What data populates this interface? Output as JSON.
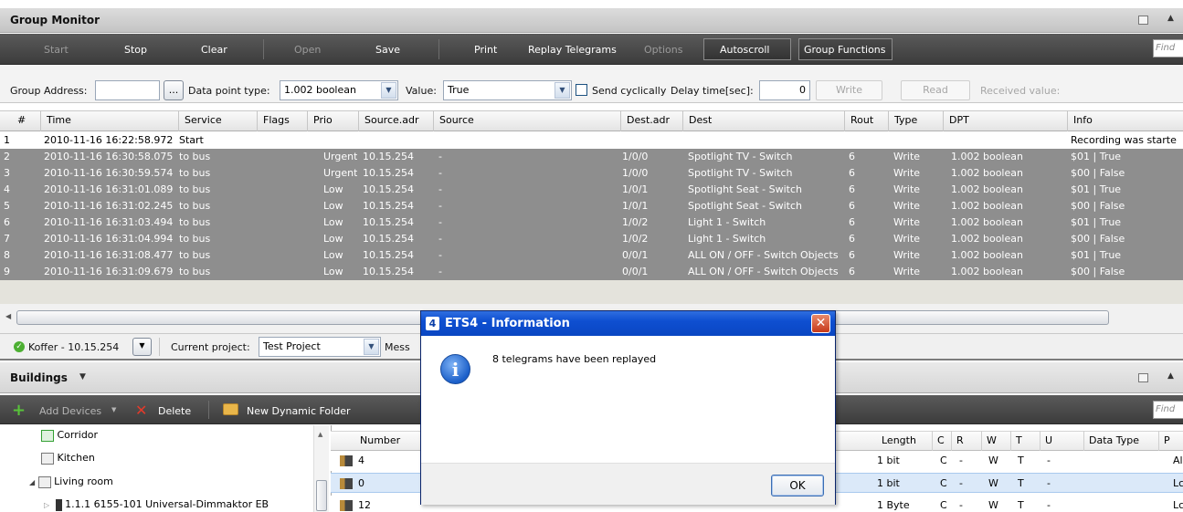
{
  "group_monitor": {
    "title": "Group Monitor",
    "toolbar": {
      "start": "Start",
      "stop": "Stop",
      "clear": "Clear",
      "open": "Open",
      "save": "Save",
      "print": "Print",
      "replay": "Replay Telegrams",
      "options": "Options",
      "autoscroll": "Autoscroll",
      "group_functions": "Group Functions",
      "find_placeholder": "Find"
    },
    "form": {
      "group_address_label": "Group Address:",
      "group_address_value": "",
      "browse_label": "...",
      "dpt_label": "Data point type:",
      "dpt_value": "1.002 boolean",
      "value_label": "Value:",
      "value_value": "True",
      "send_cyclically_label": "Send cyclically",
      "send_cyclically_checked": false,
      "delay_label": "Delay time[sec]:",
      "delay_value": "0",
      "write_label": "Write",
      "read_label": "Read",
      "received_label": "Received value:"
    },
    "columns": [
      "#",
      "Time",
      "Service",
      "Flags",
      "Prio",
      "Source.adr",
      "Source",
      "Dest.adr",
      "Dest",
      "Rout",
      "Type",
      "DPT",
      "Info"
    ],
    "rows": [
      {
        "n": "1",
        "time": "2010-11-16 16:22:58.972",
        "service": "Start",
        "flags": "",
        "prio": "",
        "src_adr": "",
        "src": "",
        "dest_adr": "",
        "dest": "",
        "rout": "",
        "type": "",
        "dpt": "",
        "info": "Recording was starte"
      },
      {
        "n": "2",
        "time": "2010-11-16 16:30:58.075",
        "service": "to bus",
        "flags": "",
        "prio": "Urgent",
        "src_adr": "10.15.254",
        "src": "-",
        "dest_adr": "1/0/0",
        "dest": "Spotlight TV - Switch",
        "rout": "6",
        "type": "Write",
        "dpt": "1.002 boolean",
        "info": "$01 | True"
      },
      {
        "n": "3",
        "time": "2010-11-16 16:30:59.574",
        "service": "to bus",
        "flags": "",
        "prio": "Urgent",
        "src_adr": "10.15.254",
        "src": "-",
        "dest_adr": "1/0/0",
        "dest": "Spotlight TV - Switch",
        "rout": "6",
        "type": "Write",
        "dpt": "1.002 boolean",
        "info": "$00 | False"
      },
      {
        "n": "4",
        "time": "2010-11-16 16:31:01.089",
        "service": "to bus",
        "flags": "",
        "prio": "Low",
        "src_adr": "10.15.254",
        "src": "-",
        "dest_adr": "1/0/1",
        "dest": "Spotlight Seat - Switch",
        "rout": "6",
        "type": "Write",
        "dpt": "1.002 boolean",
        "info": "$01 | True"
      },
      {
        "n": "5",
        "time": "2010-11-16 16:31:02.245",
        "service": "to bus",
        "flags": "",
        "prio": "Low",
        "src_adr": "10.15.254",
        "src": "-",
        "dest_adr": "1/0/1",
        "dest": "Spotlight Seat - Switch",
        "rout": "6",
        "type": "Write",
        "dpt": "1.002 boolean",
        "info": "$00 | False"
      },
      {
        "n": "6",
        "time": "2010-11-16 16:31:03.494",
        "service": "to bus",
        "flags": "",
        "prio": "Low",
        "src_adr": "10.15.254",
        "src": "-",
        "dest_adr": "1/0/2",
        "dest": "Light 1 - Switch",
        "rout": "6",
        "type": "Write",
        "dpt": "1.002 boolean",
        "info": "$01 | True"
      },
      {
        "n": "7",
        "time": "2010-11-16 16:31:04.994",
        "service": "to bus",
        "flags": "",
        "prio": "Low",
        "src_adr": "10.15.254",
        "src": "-",
        "dest_adr": "1/0/2",
        "dest": "Light 1 - Switch",
        "rout": "6",
        "type": "Write",
        "dpt": "1.002 boolean",
        "info": "$00 | False"
      },
      {
        "n": "8",
        "time": "2010-11-16 16:31:08.477",
        "service": "to bus",
        "flags": "",
        "prio": "Low",
        "src_adr": "10.15.254",
        "src": "-",
        "dest_adr": "0/0/1",
        "dest": "ALL ON / OFF - Switch Objects",
        "rout": "6",
        "type": "Write",
        "dpt": "1.002 boolean",
        "info": "$01 | True"
      },
      {
        "n": "9",
        "time": "2010-11-16 16:31:09.679",
        "service": "to bus",
        "flags": "",
        "prio": "Low",
        "src_adr": "10.15.254",
        "src": "-",
        "dest_adr": "0/0/1",
        "dest": "ALL ON / OFF - Switch Objects",
        "rout": "6",
        "type": "Write",
        "dpt": "1.002 boolean",
        "info": "$00 | False"
      }
    ]
  },
  "status": {
    "interface": "Koffer - 10.15.254",
    "project_label": "Current project:",
    "project_value": "Test Project",
    "message_label": "Mess"
  },
  "buildings": {
    "title": "Buildings",
    "toolbar": {
      "add_devices": "Add Devices",
      "delete": "Delete",
      "new_folder": "New Dynamic Folder",
      "find_placeholder": "Find"
    },
    "tree": [
      {
        "label": "Corridor"
      },
      {
        "label": "Kitchen"
      },
      {
        "label": "Living room"
      },
      {
        "label": "1.1.1  6155-101 Universal-Dimmaktor EB"
      }
    ],
    "object_columns_left": [
      "Number"
    ],
    "object_columns_right": [
      "Length",
      "C",
      "R",
      "W",
      "T",
      "U",
      "Data Type",
      "P"
    ],
    "object_rows": [
      {
        "number": "4",
        "length": "1 bit",
        "c": "C",
        "r": "-",
        "w": "W",
        "t": "T",
        "u": "-",
        "dtype": "",
        "p": "Al"
      },
      {
        "number": "0",
        "length": "1 bit",
        "c": "C",
        "r": "-",
        "w": "W",
        "t": "T",
        "u": "-",
        "dtype": "",
        "p": "Lc"
      },
      {
        "number": "12",
        "length": "1 Byte",
        "c": "C",
        "r": "-",
        "w": "W",
        "t": "T",
        "u": "-",
        "dtype": "",
        "p": "Lc"
      }
    ]
  },
  "dialog": {
    "title": "ETS4 - Information",
    "app_icon_letter": "4",
    "message": "8 telegrams have been replayed",
    "ok": "OK",
    "icon": "info-icon"
  }
}
